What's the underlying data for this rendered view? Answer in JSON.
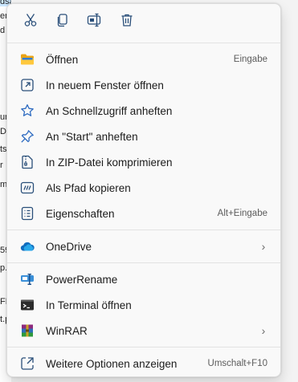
{
  "background": {
    "fragments": [
      "dsarbeiten",
      "en",
      "d",
      "",
      "d",
      "",
      "ur",
      "D",
      "ts",
      "r",
      "m",
      "",
      "59",
      "p.",
      "",
      "FE",
      "t.p",
      "",
      ""
    ]
  },
  "toolbar": {
    "cut_icon": "scissors-icon",
    "copy_icon": "copy-icon",
    "rename_icon": "rename-icon",
    "delete_icon": "trash-icon"
  },
  "menu": {
    "items": [
      {
        "label": "Öffnen",
        "shortcut": "Eingabe",
        "icon": "folder-icon"
      },
      {
        "label": "In neuem Fenster öffnen",
        "shortcut": "",
        "icon": "open-new-window-icon"
      },
      {
        "label": "An Schnellzugriff anheften",
        "shortcut": "",
        "icon": "star-icon"
      },
      {
        "label": "An \"Start\" anheften",
        "shortcut": "",
        "icon": "pin-icon"
      },
      {
        "label": "In ZIP-Datei komprimieren",
        "shortcut": "",
        "icon": "zip-icon"
      },
      {
        "label": "Als Pfad kopieren",
        "shortcut": "",
        "icon": "copy-path-icon"
      },
      {
        "label": "Eigenschaften",
        "shortcut": "Alt+Eingabe",
        "icon": "properties-icon"
      }
    ],
    "onedrive": {
      "label": "OneDrive",
      "icon": "onedrive-cloud-icon"
    },
    "tools": [
      {
        "label": "PowerRename",
        "icon": "powerrename-icon"
      },
      {
        "label": "In Terminal öffnen",
        "icon": "terminal-icon"
      },
      {
        "label": "WinRAR",
        "icon": "winrar-icon"
      }
    ],
    "more": {
      "label": "Weitere Optionen anzeigen",
      "shortcut": "Umschalt+F10",
      "icon": "more-options-icon"
    }
  }
}
